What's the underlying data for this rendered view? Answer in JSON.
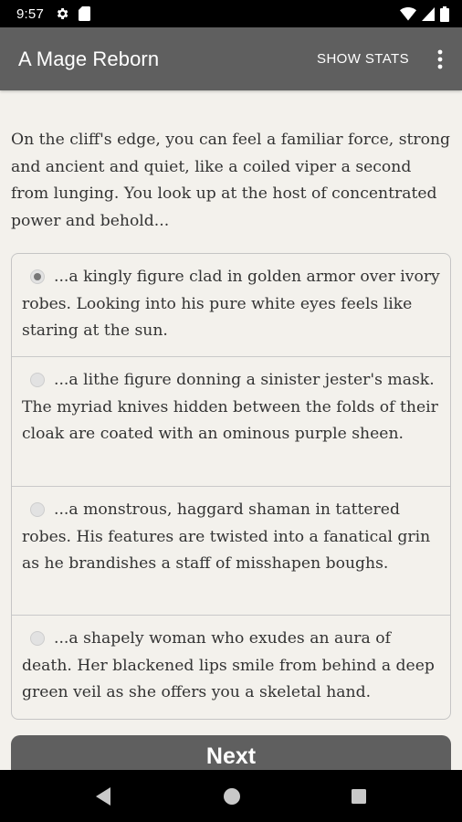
{
  "status_bar": {
    "time": "9:57",
    "icons": [
      "gear-icon",
      "sd-card-icon",
      "wifi-icon",
      "signal-icon",
      "battery-icon"
    ]
  },
  "app_bar": {
    "title": "A Mage Reborn",
    "show_stats_label": "SHOW STATS",
    "menu_icon": "overflow-menu-icon"
  },
  "passage": {
    "text": "On the cliff's edge, you can feel a familiar force, strong and ancient and quiet, like a coiled viper a second from lunging. You look up at the host of concentrated power and behold..."
  },
  "choices": [
    {
      "text": "...a kingly figure clad in golden armor over ivory robes. Looking into his pure white eyes feels like staring at the sun.",
      "selected": true
    },
    {
      "text": "...a lithe figure donning a sinister jester's mask. The myriad knives hidden between the folds of their cloak are coated with an ominous purple sheen.",
      "selected": false
    },
    {
      "text": "...a monstrous, haggard shaman in tattered robes. His features are twisted into a fanatical grin as he brandishes a staff of misshapen boughs.",
      "selected": false
    },
    {
      "text": "...a shapely woman who exudes an aura of death. Her blackened lips smile from behind a deep green veil as she offers you a skeletal hand.",
      "selected": false
    }
  ],
  "next_button": {
    "label": "Next"
  },
  "nav_bar": {
    "icons": [
      "back-icon",
      "home-icon",
      "recents-icon"
    ]
  },
  "colors": {
    "app_bar": "#5f5f5f",
    "background": "#f3f1ec",
    "text": "#333333",
    "system_bars": "#000000"
  }
}
